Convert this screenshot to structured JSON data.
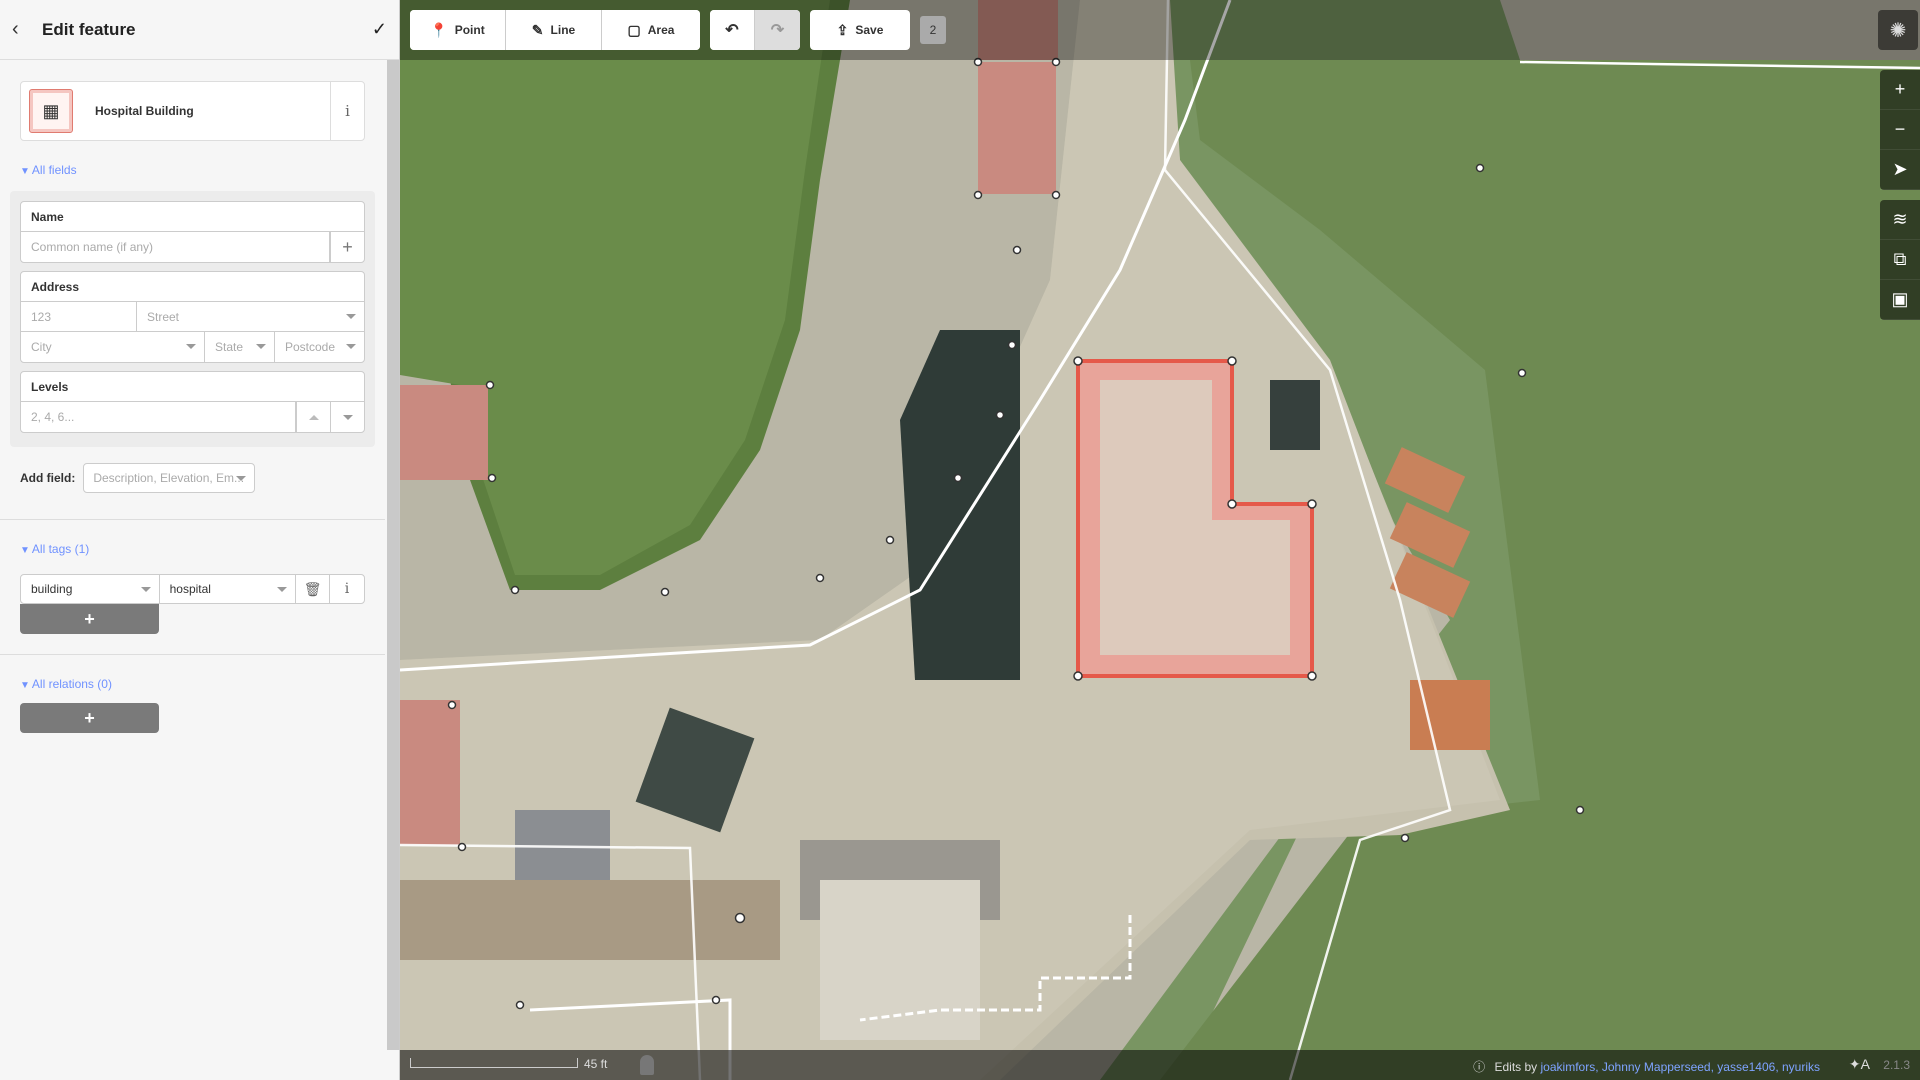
{
  "sidebar": {
    "header_title": "Edit feature",
    "preset_name": "Hospital Building",
    "all_fields_label": "All fields",
    "fields": {
      "name_label": "Name",
      "name_placeholder": "Common name (if any)",
      "address_label": "Address",
      "housenumber_placeholder": "123",
      "street_placeholder": "Street",
      "city_placeholder": "City",
      "state_placeholder": "State",
      "postcode_placeholder": "Postcode",
      "levels_label": "Levels",
      "levels_placeholder": "2, 4, 6..."
    },
    "add_field_label": "Add field:",
    "add_field_placeholder": "Description, Elevation, Em...",
    "all_tags_label": "All tags (1)",
    "tags": [
      {
        "key": "building",
        "value": "hospital"
      }
    ],
    "all_relations_label": "All relations (0)"
  },
  "toolbar": {
    "point_label": "Point",
    "line_label": "Line",
    "area_label": "Area",
    "save_label": "Save",
    "edit_count": "2"
  },
  "footer": {
    "scale_label": "45 ft",
    "attribution_prefix": "Edits by",
    "attribution_users": "joakimfors, Johnny Mapperseed, yasse1406, nyuriks",
    "version": "2.1.3"
  },
  "colors": {
    "accent": "#7092ff",
    "selected_area": "#e06e5f",
    "grass": "#5a7d3d"
  }
}
